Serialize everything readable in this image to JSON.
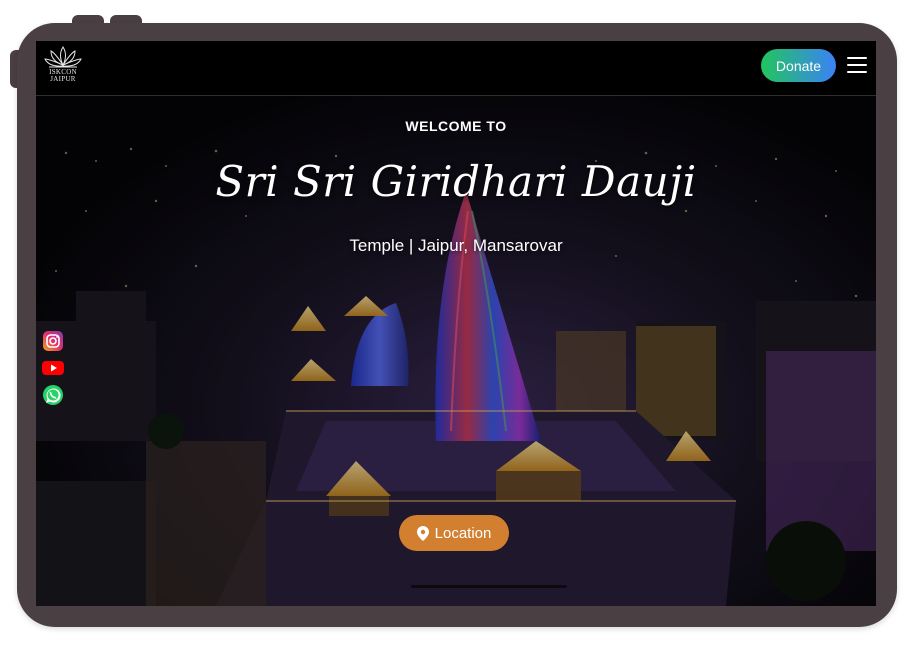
{
  "nav": {
    "logo_line1": "ISKCON",
    "logo_line2": "JAIPUR",
    "donate_label": "Donate",
    "menu_icon": "hamburger-icon"
  },
  "hero": {
    "welcome": "WELCOME TO",
    "title": "Sri Sri Giridhari Dauji",
    "subtitle": "Temple | Jaipur, Mansarovar",
    "location_label": "Location",
    "location_icon": "map-pin-icon"
  },
  "social": [
    {
      "name": "instagram-icon",
      "color": "#e1306c"
    },
    {
      "name": "youtube-icon",
      "color": "#ff0000"
    },
    {
      "name": "whatsapp-icon",
      "color": "#25d366"
    }
  ],
  "colors": {
    "donate_gradient_start": "#22c55e",
    "donate_gradient_end": "#3b82f6",
    "location_button": "#d2802f",
    "device_frame": "#4a3f43"
  }
}
